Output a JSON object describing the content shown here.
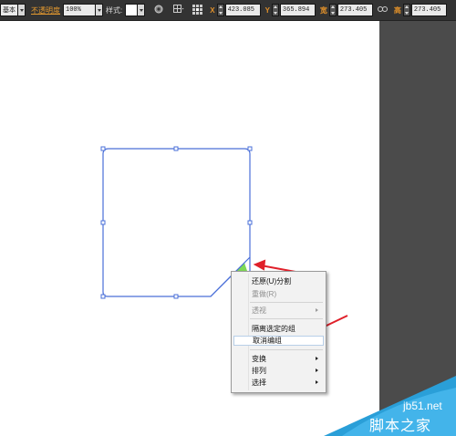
{
  "toolbar": {
    "workspace": "基本",
    "opacity_label": "不透明度",
    "opacity_value": "100%",
    "style_label": "样式:",
    "x_value": "423.085",
    "y_value": "365.894",
    "w_value": "273.405",
    "h_value": "273.405",
    "x_icon": "X",
    "y_icon": "Y",
    "w_icon": "宽",
    "h_icon": "高"
  },
  "context_menu": {
    "items": [
      {
        "label": "还原(U)分割",
        "disabled": false
      },
      {
        "label": "重做(R)",
        "disabled": true
      },
      {
        "label": "透视",
        "disabled": true,
        "submenu": true
      },
      {
        "label": "隔离选定的组",
        "disabled": false
      },
      {
        "label": "取消编组",
        "disabled": false,
        "highlighted": true
      },
      {
        "label": "变换",
        "disabled": false,
        "submenu": true
      },
      {
        "label": "排列",
        "disabled": false,
        "submenu": true
      },
      {
        "label": "选择",
        "disabled": false,
        "submenu": true
      }
    ]
  },
  "colors": {
    "selection": "#4a6fd8",
    "annotation_arrow": "#e0202a",
    "highlight_fill": "#7ed957",
    "watermark_blue": "#2a9fd8"
  },
  "watermark": {
    "domain": "jb51.net",
    "text": "脚本之家"
  }
}
